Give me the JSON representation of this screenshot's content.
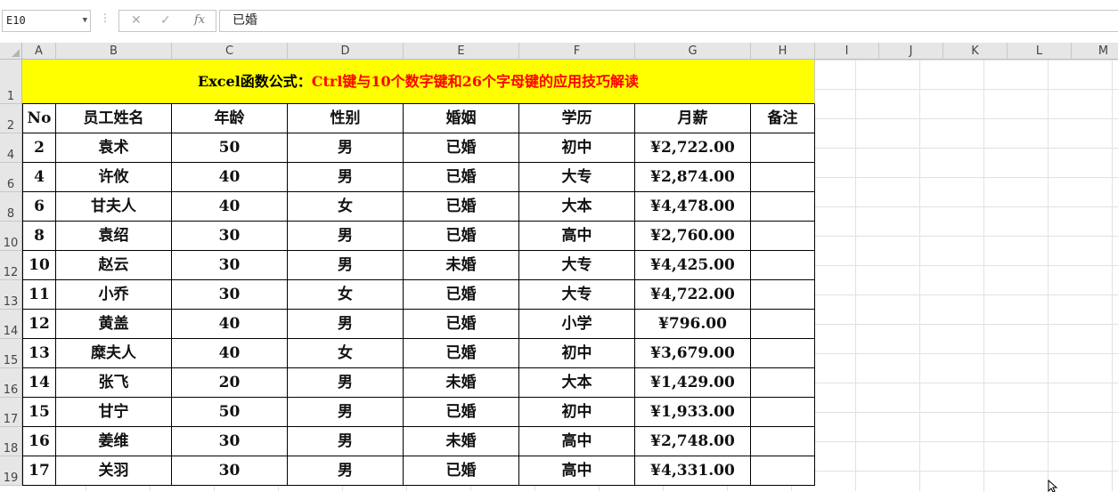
{
  "formula_bar": {
    "name_box": "E10",
    "cancel_glyph": "✕",
    "enter_glyph": "✓",
    "fx_glyph": "fx",
    "content": "已婚"
  },
  "columns": [
    "A",
    "B",
    "C",
    "D",
    "E",
    "F",
    "G",
    "H",
    "I",
    "J",
    "K",
    "L",
    "M"
  ],
  "rows": [
    "1",
    "2",
    "4",
    "6",
    "8",
    "10",
    "12",
    "13",
    "14",
    "15",
    "16",
    "17",
    "18",
    "19"
  ],
  "sheet": {
    "title_black": "Excel函数公式：",
    "title_red": "Ctrl键与10个数字键和26个字母键的应用技巧解读",
    "headers": [
      "No",
      "员工姓名",
      "年龄",
      "性别",
      "婚姻",
      "学历",
      "月薪",
      "备注"
    ],
    "data": [
      [
        "2",
        "袁术",
        "50",
        "男",
        "已婚",
        "初中",
        "¥2,722.00",
        ""
      ],
      [
        "4",
        "许攸",
        "40",
        "男",
        "已婚",
        "大专",
        "¥2,874.00",
        ""
      ],
      [
        "6",
        "甘夫人",
        "40",
        "女",
        "已婚",
        "大本",
        "¥4,478.00",
        ""
      ],
      [
        "8",
        "袁绍",
        "30",
        "男",
        "已婚",
        "高中",
        "¥2,760.00",
        ""
      ],
      [
        "10",
        "赵云",
        "30",
        "男",
        "未婚",
        "大专",
        "¥4,425.00",
        ""
      ],
      [
        "11",
        "小乔",
        "30",
        "女",
        "已婚",
        "大专",
        "¥4,722.00",
        ""
      ],
      [
        "12",
        "黄盖",
        "40",
        "男",
        "已婚",
        "小学",
        "¥796.00",
        ""
      ],
      [
        "13",
        "糜夫人",
        "40",
        "女",
        "已婚",
        "初中",
        "¥3,679.00",
        ""
      ],
      [
        "14",
        "张飞",
        "20",
        "男",
        "未婚",
        "大本",
        "¥1,429.00",
        ""
      ],
      [
        "15",
        "甘宁",
        "50",
        "男",
        "已婚",
        "初中",
        "¥1,933.00",
        ""
      ],
      [
        "16",
        "姜维",
        "30",
        "男",
        "未婚",
        "高中",
        "¥2,748.00",
        ""
      ],
      [
        "17",
        "关羽",
        "30",
        "男",
        "已婚",
        "高中",
        "¥4,331.00",
        ""
      ]
    ]
  },
  "colors": {
    "title_fill": "#ffff00",
    "title_accent": "#ff0000",
    "header_bg": "#e6e6e6"
  }
}
